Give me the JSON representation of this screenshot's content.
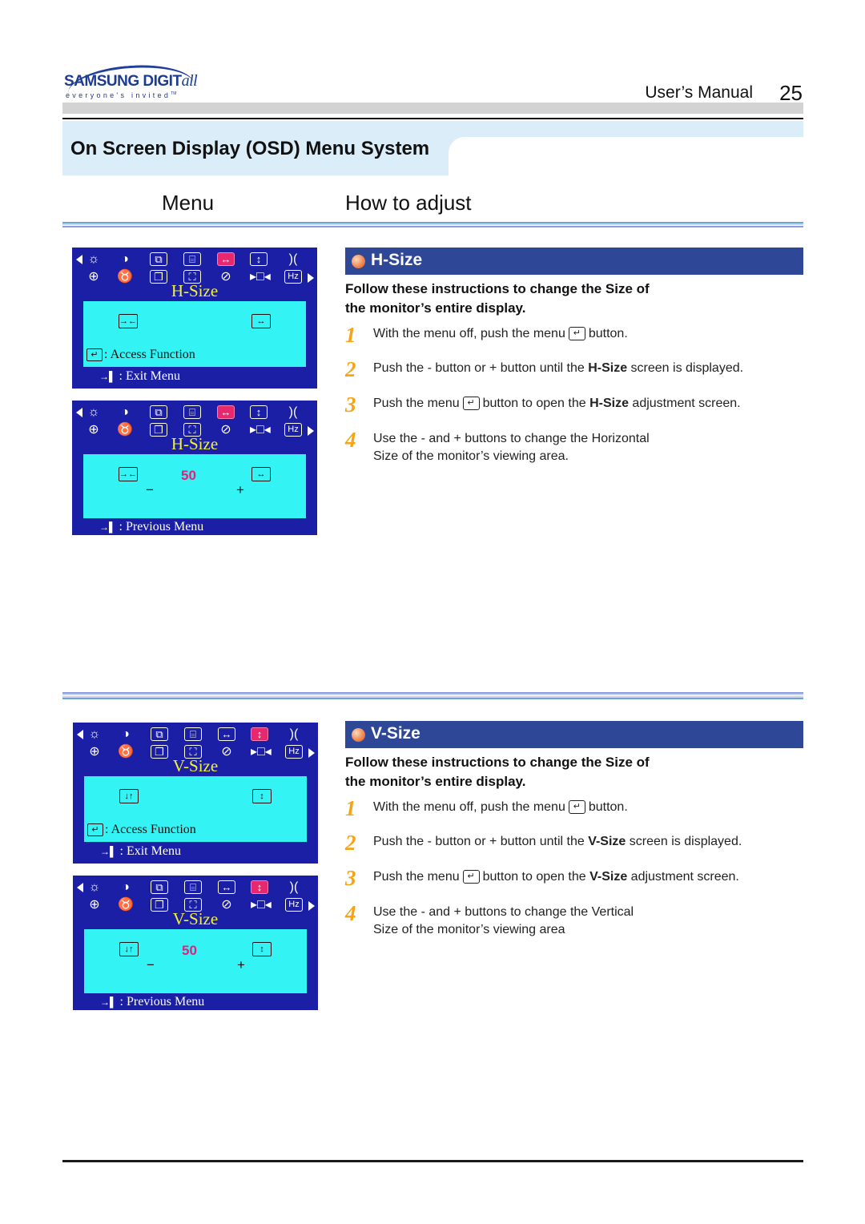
{
  "header": {
    "logo_brand": "SAMSUNG DIGIT",
    "logo_brand_suffix": "all",
    "logo_tagline": "everyone's invited",
    "logo_tm": "TM",
    "manual_label": "User’s  Manual",
    "page_number": "25",
    "section_title": "On Screen Display (OSD) Menu System"
  },
  "columns": {
    "menu": "Menu",
    "how_to": "How to adjust"
  },
  "osd_common": {
    "icons_row1": [
      "brightness-icon",
      "contrast-icon",
      "position-icon",
      "size-icon",
      "h-size-icon",
      "v-size-icon",
      "pincushion-icon"
    ],
    "icons_row2": [
      "geometry-icon",
      "moire-icon",
      "recall-icon",
      "zoom-icon",
      "degauss-icon",
      "h-position-icon",
      "frequency-icon"
    ],
    "hz_label": "Hz",
    "access_function": ": Access Function",
    "exit_menu": ": Exit Menu",
    "previous_menu": ":  Previous Menu",
    "minus": "−",
    "plus": "+"
  },
  "sections": [
    {
      "id": "h-size",
      "osd_title": "H-Size",
      "selected_icon": "h-size-icon",
      "value": "50",
      "bar_title": "H-Size",
      "lead_line1": "Follow these instructions to change the  Size of",
      "lead_line2": "the monitor’s entire display.",
      "steps": [
        {
          "num": "1",
          "pre": "With the menu off, push the menu",
          "post": "button.",
          "bold": "",
          "post2": ""
        },
        {
          "num": "2",
          "pre": "Push the  - button or  + button until the ",
          "bold": "H-Size",
          "post": "  screen is displayed."
        },
        {
          "num": "3",
          "pre": "Push the menu",
          "mid": "button to open the ",
          "bold": "H-Size",
          "post": " adjustment screen."
        },
        {
          "num": "4",
          "line1": "Use the  - and  + buttons to change the Horizontal",
          "line2": "Size of the monitor’s viewing area."
        }
      ]
    },
    {
      "id": "v-size",
      "osd_title": "V-Size",
      "selected_icon": "v-size-icon",
      "value": "50",
      "bar_title": "V-Size",
      "lead_line1": "Follow these instructions to change the  Size of",
      "lead_line2": "the monitor’s entire display.",
      "steps": [
        {
          "num": "1",
          "pre": "With the menu off, push the menu",
          "post": "button."
        },
        {
          "num": "2",
          "pre": "Push the  - button or  + button until the ",
          "bold": "V-Size",
          "post": " screen is displayed."
        },
        {
          "num": "3",
          "pre": "Push the menu",
          "mid": "button to open the ",
          "bold": "V-Size",
          "post": " adjustment screen."
        },
        {
          "num": "4",
          "line1": "Use the  - and  + buttons to change the Vertical",
          "line2": "Size of the monitor’s viewing area"
        }
      ]
    }
  ],
  "colors": {
    "osd_background": "#1b1fa5",
    "osd_panel": "#33f3f5",
    "osd_title": "#f2f23c",
    "osd_selected": "#e8286e",
    "section_bar": "#2e4797",
    "step_number": "#f6a413",
    "title_box": "#dcedfa"
  }
}
